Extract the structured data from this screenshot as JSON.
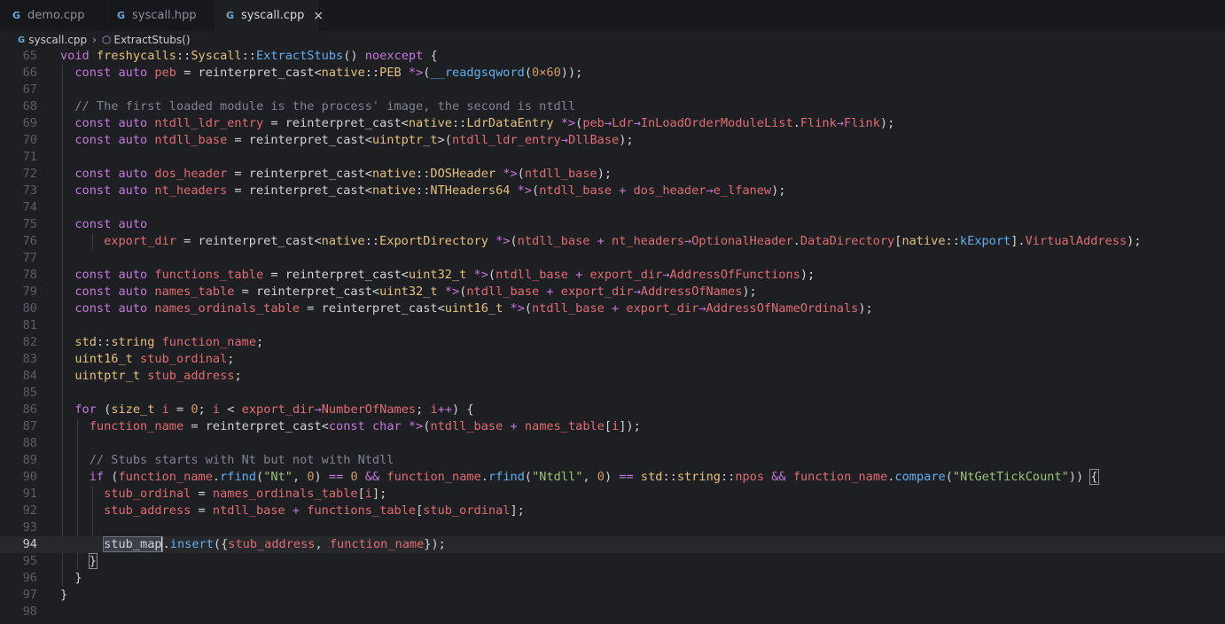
{
  "tabs": [
    {
      "label": "demo.cpp",
      "active": false
    },
    {
      "label": "syscall.hpp",
      "active": false
    },
    {
      "label": "syscall.cpp",
      "active": true
    }
  ],
  "tab_icon_glyph": "G",
  "close_glyph": "×",
  "breadcrumb": {
    "file": "syscall.cpp",
    "symbol": "ExtractStubs()"
  },
  "current_line": 94,
  "lines": [
    {
      "n": "65",
      "tokens": [
        [
          "k",
          "void "
        ],
        [
          "t",
          "freshycalls"
        ],
        [
          "p",
          "::"
        ],
        [
          "t",
          "Syscall"
        ],
        [
          "p",
          "::"
        ],
        [
          "f",
          "ExtractStubs"
        ],
        [
          "p",
          "() "
        ],
        [
          "k",
          "noexcept"
        ],
        [
          "p",
          " {"
        ]
      ]
    },
    {
      "n": "66",
      "tokens": [
        [
          "p",
          "  "
        ],
        [
          "k",
          "const auto "
        ],
        [
          "v",
          "peb"
        ],
        [
          "p",
          " = reinterpret_cast<"
        ],
        [
          "t",
          "native"
        ],
        [
          "p",
          "::"
        ],
        [
          "t",
          "PEB"
        ],
        [
          "p",
          " "
        ],
        [
          "o",
          "*>"
        ],
        [
          "p",
          "("
        ],
        [
          "f",
          "__readgsqword"
        ],
        [
          "p",
          "("
        ],
        [
          "n",
          "0×60"
        ],
        [
          "p",
          "));"
        ]
      ]
    },
    {
      "n": "67",
      "tokens": []
    },
    {
      "n": "68",
      "tokens": [
        [
          "p",
          "  "
        ],
        [
          "c",
          "// The first loaded module is the process' image, the second is ntdll"
        ]
      ]
    },
    {
      "n": "69",
      "tokens": [
        [
          "p",
          "  "
        ],
        [
          "k",
          "const auto "
        ],
        [
          "v",
          "ntdll_ldr_entry"
        ],
        [
          "p",
          " = reinterpret_cast<"
        ],
        [
          "t",
          "native"
        ],
        [
          "p",
          "::"
        ],
        [
          "t",
          "LdrDataEntry"
        ],
        [
          "p",
          " "
        ],
        [
          "o",
          "*>"
        ],
        [
          "p",
          "("
        ],
        [
          "v",
          "peb"
        ],
        [
          "o",
          "→"
        ],
        [
          "v",
          "Ldr"
        ],
        [
          "o",
          "→"
        ],
        [
          "v",
          "InLoadOrderModuleList"
        ],
        [
          "p",
          "."
        ],
        [
          "v",
          "Flink"
        ],
        [
          "o",
          "→"
        ],
        [
          "v",
          "Flink"
        ],
        [
          "p",
          ");"
        ]
      ]
    },
    {
      "n": "70",
      "tokens": [
        [
          "p",
          "  "
        ],
        [
          "k",
          "const auto "
        ],
        [
          "v",
          "ntdll_base"
        ],
        [
          "p",
          " = reinterpret_cast<"
        ],
        [
          "t",
          "uintptr_t"
        ],
        [
          "p",
          ">("
        ],
        [
          "v",
          "ntdll_ldr_entry"
        ],
        [
          "o",
          "→"
        ],
        [
          "v",
          "DllBase"
        ],
        [
          "p",
          ");"
        ]
      ]
    },
    {
      "n": "71",
      "tokens": []
    },
    {
      "n": "72",
      "tokens": [
        [
          "p",
          "  "
        ],
        [
          "k",
          "const auto "
        ],
        [
          "v",
          "dos_header"
        ],
        [
          "p",
          " = reinterpret_cast<"
        ],
        [
          "t",
          "native"
        ],
        [
          "p",
          "::"
        ],
        [
          "t",
          "DOSHeader"
        ],
        [
          "p",
          " "
        ],
        [
          "o",
          "*>"
        ],
        [
          "p",
          "("
        ],
        [
          "v",
          "ntdll_base"
        ],
        [
          "p",
          ");"
        ]
      ]
    },
    {
      "n": "73",
      "tokens": [
        [
          "p",
          "  "
        ],
        [
          "k",
          "const auto "
        ],
        [
          "v",
          "nt_headers"
        ],
        [
          "p",
          " = reinterpret_cast<"
        ],
        [
          "t",
          "native"
        ],
        [
          "p",
          "::"
        ],
        [
          "t",
          "NTHeaders64"
        ],
        [
          "p",
          " "
        ],
        [
          "o",
          "*>"
        ],
        [
          "p",
          "("
        ],
        [
          "v",
          "ntdll_base"
        ],
        [
          "p",
          " "
        ],
        [
          "o",
          "+"
        ],
        [
          "p",
          " "
        ],
        [
          "v",
          "dos_header"
        ],
        [
          "o",
          "→"
        ],
        [
          "v",
          "e_lfanew"
        ],
        [
          "p",
          ");"
        ]
      ]
    },
    {
      "n": "74",
      "tokens": []
    },
    {
      "n": "75",
      "tokens": [
        [
          "p",
          "  "
        ],
        [
          "k",
          "const auto"
        ]
      ]
    },
    {
      "n": "76",
      "tokens": [
        [
          "p",
          "      "
        ],
        [
          "v",
          "export_dir"
        ],
        [
          "p",
          " = reinterpret_cast<"
        ],
        [
          "t",
          "native"
        ],
        [
          "p",
          "::"
        ],
        [
          "t",
          "ExportDirectory"
        ],
        [
          "p",
          " "
        ],
        [
          "o",
          "*>"
        ],
        [
          "p",
          "("
        ],
        [
          "v",
          "ntdll_base"
        ],
        [
          "p",
          " "
        ],
        [
          "o",
          "+"
        ],
        [
          "p",
          " "
        ],
        [
          "v",
          "nt_headers"
        ],
        [
          "o",
          "→"
        ],
        [
          "v",
          "OptionalHeader"
        ],
        [
          "p",
          "."
        ],
        [
          "v",
          "DataDirectory"
        ],
        [
          "p",
          "["
        ],
        [
          "t",
          "native"
        ],
        [
          "p",
          "::"
        ],
        [
          "f",
          "kExport"
        ],
        [
          "p",
          "]."
        ],
        [
          "v",
          "VirtualAddress"
        ],
        [
          "p",
          ");"
        ]
      ]
    },
    {
      "n": "77",
      "tokens": []
    },
    {
      "n": "78",
      "tokens": [
        [
          "p",
          "  "
        ],
        [
          "k",
          "const auto "
        ],
        [
          "v",
          "functions_table"
        ],
        [
          "p",
          " = reinterpret_cast<"
        ],
        [
          "t",
          "uint32_t"
        ],
        [
          "p",
          " "
        ],
        [
          "o",
          "*>"
        ],
        [
          "p",
          "("
        ],
        [
          "v",
          "ntdll_base"
        ],
        [
          "p",
          " "
        ],
        [
          "o",
          "+"
        ],
        [
          "p",
          " "
        ],
        [
          "v",
          "export_dir"
        ],
        [
          "o",
          "→"
        ],
        [
          "v",
          "AddressOfFunctions"
        ],
        [
          "p",
          ");"
        ]
      ]
    },
    {
      "n": "79",
      "tokens": [
        [
          "p",
          "  "
        ],
        [
          "k",
          "const auto "
        ],
        [
          "v",
          "names_table"
        ],
        [
          "p",
          " = reinterpret_cast<"
        ],
        [
          "t",
          "uint32_t"
        ],
        [
          "p",
          " "
        ],
        [
          "o",
          "*>"
        ],
        [
          "p",
          "("
        ],
        [
          "v",
          "ntdll_base"
        ],
        [
          "p",
          " "
        ],
        [
          "o",
          "+"
        ],
        [
          "p",
          " "
        ],
        [
          "v",
          "export_dir"
        ],
        [
          "o",
          "→"
        ],
        [
          "v",
          "AddressOfNames"
        ],
        [
          "p",
          ");"
        ]
      ]
    },
    {
      "n": "80",
      "tokens": [
        [
          "p",
          "  "
        ],
        [
          "k",
          "const auto "
        ],
        [
          "v",
          "names_ordinals_table"
        ],
        [
          "p",
          " = reinterpret_cast<"
        ],
        [
          "t",
          "uint16_t"
        ],
        [
          "p",
          " "
        ],
        [
          "o",
          "*>"
        ],
        [
          "p",
          "("
        ],
        [
          "v",
          "ntdll_base"
        ],
        [
          "p",
          " "
        ],
        [
          "o",
          "+"
        ],
        [
          "p",
          " "
        ],
        [
          "v",
          "export_dir"
        ],
        [
          "o",
          "→"
        ],
        [
          "v",
          "AddressOfNameOrdinals"
        ],
        [
          "p",
          ");"
        ]
      ]
    },
    {
      "n": "81",
      "tokens": []
    },
    {
      "n": "82",
      "tokens": [
        [
          "p",
          "  "
        ],
        [
          "t",
          "std"
        ],
        [
          "p",
          "::"
        ],
        [
          "t",
          "string"
        ],
        [
          "p",
          " "
        ],
        [
          "v",
          "function_name"
        ],
        [
          "p",
          ";"
        ]
      ]
    },
    {
      "n": "83",
      "tokens": [
        [
          "p",
          "  "
        ],
        [
          "t",
          "uint16_t"
        ],
        [
          "p",
          " "
        ],
        [
          "v",
          "stub_ordinal"
        ],
        [
          "p",
          ";"
        ]
      ]
    },
    {
      "n": "84",
      "tokens": [
        [
          "p",
          "  "
        ],
        [
          "t",
          "uintptr_t"
        ],
        [
          "p",
          " "
        ],
        [
          "v",
          "stub_address"
        ],
        [
          "p",
          ";"
        ]
      ]
    },
    {
      "n": "85",
      "tokens": []
    },
    {
      "n": "86",
      "tokens": [
        [
          "p",
          "  "
        ],
        [
          "k",
          "for"
        ],
        [
          "p",
          " ("
        ],
        [
          "t",
          "size_t"
        ],
        [
          "p",
          " "
        ],
        [
          "v",
          "i"
        ],
        [
          "p",
          " = "
        ],
        [
          "n",
          "0"
        ],
        [
          "p",
          "; "
        ],
        [
          "v",
          "i"
        ],
        [
          "p",
          " < "
        ],
        [
          "v",
          "export_dir"
        ],
        [
          "o",
          "→"
        ],
        [
          "v",
          "NumberOfNames"
        ],
        [
          "p",
          "; "
        ],
        [
          "v",
          "i"
        ],
        [
          "o",
          "++"
        ],
        [
          "p",
          ") {"
        ]
      ]
    },
    {
      "n": "87",
      "tokens": [
        [
          "p",
          "    "
        ],
        [
          "v",
          "function_name"
        ],
        [
          "p",
          " = reinterpret_cast<"
        ],
        [
          "k",
          "const char"
        ],
        [
          "p",
          " "
        ],
        [
          "o",
          "*>"
        ],
        [
          "p",
          "("
        ],
        [
          "v",
          "ntdll_base"
        ],
        [
          "p",
          " "
        ],
        [
          "o",
          "+"
        ],
        [
          "p",
          " "
        ],
        [
          "v",
          "names_table"
        ],
        [
          "p",
          "["
        ],
        [
          "v",
          "i"
        ],
        [
          "p",
          "]);"
        ]
      ]
    },
    {
      "n": "88",
      "tokens": []
    },
    {
      "n": "89",
      "tokens": [
        [
          "p",
          "    "
        ],
        [
          "c",
          "// Stubs starts with Nt but not with Ntdll"
        ]
      ]
    },
    {
      "n": "90",
      "tokens": [
        [
          "p",
          "    "
        ],
        [
          "k",
          "if"
        ],
        [
          "p",
          " ("
        ],
        [
          "v",
          "function_name"
        ],
        [
          "p",
          "."
        ],
        [
          "f",
          "rfind"
        ],
        [
          "p",
          "("
        ],
        [
          "s",
          "\"Nt\""
        ],
        [
          "p",
          ", "
        ],
        [
          "n",
          "0"
        ],
        [
          "p",
          ") "
        ],
        [
          "o",
          "=="
        ],
        [
          "p",
          " "
        ],
        [
          "n",
          "0"
        ],
        [
          "p",
          " "
        ],
        [
          "o",
          "&&"
        ],
        [
          "p",
          " "
        ],
        [
          "v",
          "function_name"
        ],
        [
          "p",
          "."
        ],
        [
          "f",
          "rfind"
        ],
        [
          "p",
          "("
        ],
        [
          "s",
          "\"Ntdll\""
        ],
        [
          "p",
          ", "
        ],
        [
          "n",
          "0"
        ],
        [
          "p",
          ") "
        ],
        [
          "o",
          "=="
        ],
        [
          "p",
          " "
        ],
        [
          "t",
          "std"
        ],
        [
          "p",
          "::"
        ],
        [
          "t",
          "string"
        ],
        [
          "p",
          "::"
        ],
        [
          "v",
          "npos"
        ],
        [
          "p",
          " "
        ],
        [
          "o",
          "&&"
        ],
        [
          "p",
          " "
        ],
        [
          "v",
          "function_name"
        ],
        [
          "p",
          "."
        ],
        [
          "f",
          "compare"
        ],
        [
          "p",
          "("
        ],
        [
          "s",
          "\"NtGetTickCount\""
        ],
        [
          "p",
          ")) "
        ],
        [
          "brk",
          "{"
        ]
      ]
    },
    {
      "n": "91",
      "tokens": [
        [
          "p",
          "      "
        ],
        [
          "v",
          "stub_ordinal"
        ],
        [
          "p",
          " = "
        ],
        [
          "v",
          "names_ordinals_table"
        ],
        [
          "p",
          "["
        ],
        [
          "v",
          "i"
        ],
        [
          "p",
          "];"
        ]
      ]
    },
    {
      "n": "92",
      "tokens": [
        [
          "p",
          "      "
        ],
        [
          "v",
          "stub_address"
        ],
        [
          "p",
          " = "
        ],
        [
          "v",
          "ntdll_base"
        ],
        [
          "p",
          " "
        ],
        [
          "o",
          "+"
        ],
        [
          "p",
          " "
        ],
        [
          "v",
          "functions_table"
        ],
        [
          "p",
          "["
        ],
        [
          "v",
          "stub_ordinal"
        ],
        [
          "p",
          "];"
        ]
      ]
    },
    {
      "n": "93",
      "tokens": []
    },
    {
      "n": "94",
      "tokens": [
        [
          "p",
          "      "
        ],
        [
          "hl",
          "stub_map"
        ],
        [
          "cursor",
          ""
        ],
        [
          "p",
          "."
        ],
        [
          "f",
          "insert"
        ],
        [
          "p",
          "({"
        ],
        [
          "v",
          "stub_address"
        ],
        [
          "p",
          ", "
        ],
        [
          "v",
          "function_name"
        ],
        [
          "p",
          "});"
        ]
      ]
    },
    {
      "n": "95",
      "tokens": [
        [
          "p",
          "    "
        ],
        [
          "brk",
          "}"
        ]
      ]
    },
    {
      "n": "96",
      "tokens": [
        [
          "p",
          "  }"
        ]
      ]
    },
    {
      "n": "97",
      "tokens": [
        [
          "p",
          "}"
        ]
      ]
    },
    {
      "n": "98",
      "tokens": []
    }
  ]
}
